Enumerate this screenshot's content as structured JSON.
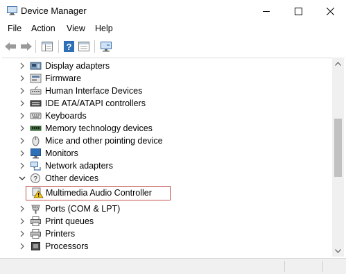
{
  "window": {
    "title": "Device Manager"
  },
  "menubar": {
    "items": [
      "File",
      "Action",
      "View",
      "Help"
    ]
  },
  "toolbar": {
    "buttons": [
      "back-icon",
      "forward-icon",
      "show-hide-console-tree-icon",
      "help-icon",
      "properties-icon",
      "scan-hardware-icon"
    ]
  },
  "tree": {
    "rows": [
      {
        "label": "Display adapters",
        "icon": "display-adapter-icon",
        "expanded": false
      },
      {
        "label": "Firmware",
        "icon": "firmware-icon",
        "expanded": false
      },
      {
        "label": "Human Interface Devices",
        "icon": "hid-icon",
        "expanded": false
      },
      {
        "label": "IDE ATA/ATAPI controllers",
        "icon": "ide-controller-icon",
        "expanded": false
      },
      {
        "label": "Keyboards",
        "icon": "keyboard-icon",
        "expanded": false
      },
      {
        "label": "Memory technology devices",
        "icon": "memory-icon",
        "expanded": false
      },
      {
        "label": "Mice and other pointing device",
        "icon": "mouse-icon",
        "expanded": false
      },
      {
        "label": "Monitors",
        "icon": "monitor-icon",
        "expanded": false
      },
      {
        "label": "Network adapters",
        "icon": "network-icon",
        "expanded": false
      },
      {
        "label": "Other devices",
        "icon": "other-devices-icon",
        "expanded": true
      },
      {
        "label": "Ports (COM & LPT)",
        "icon": "port-icon",
        "expanded": false
      },
      {
        "label": "Print queues",
        "icon": "printer-icon",
        "expanded": false
      },
      {
        "label": "Printers",
        "icon": "printer-icon",
        "expanded": false
      },
      {
        "label": "Processors",
        "icon": "processor-icon",
        "expanded": false
      }
    ],
    "selected_child": {
      "label": "Multimedia Audio Controller",
      "icon": "warning-device-icon",
      "status": "warning"
    }
  },
  "colors": {
    "selection_border": "#c0504d",
    "folder_blue": "#2f6fb5",
    "warning_yellow": "#f2c811"
  }
}
